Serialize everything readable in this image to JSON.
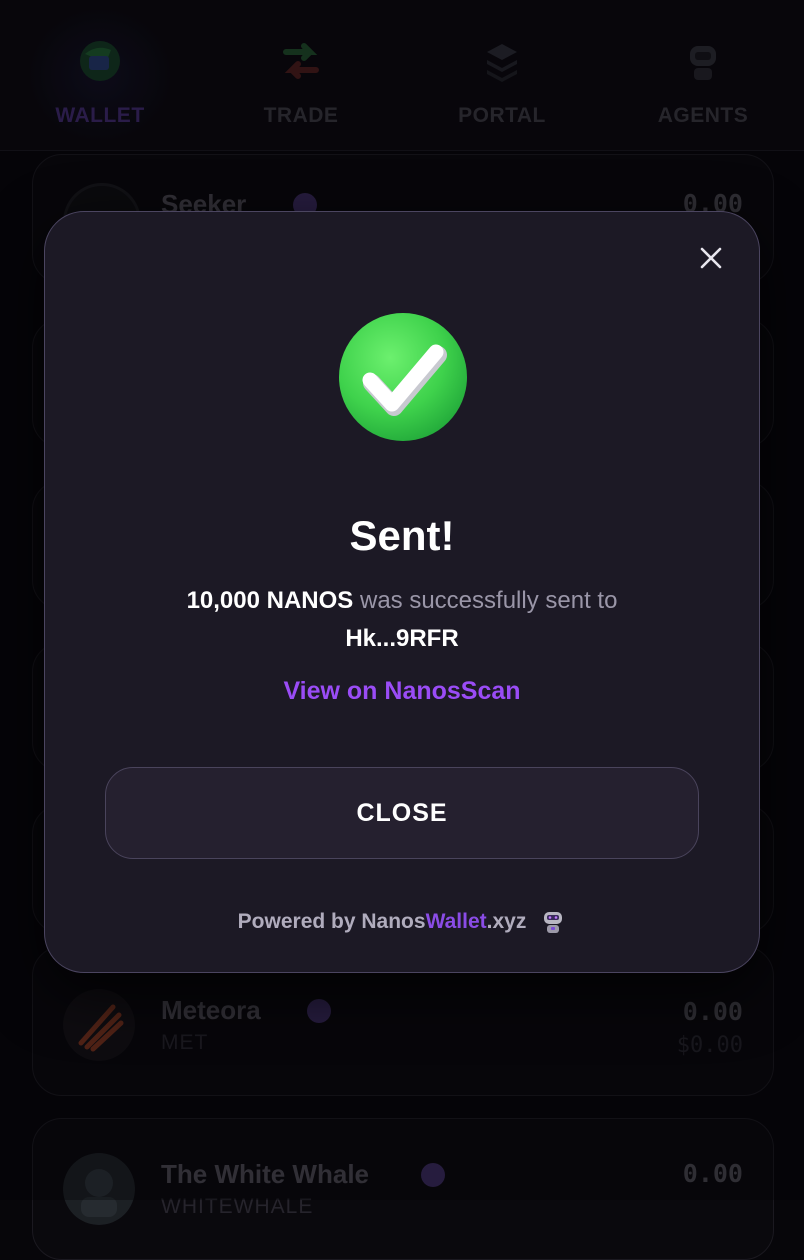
{
  "nav": {
    "items": [
      {
        "label": "WALLET",
        "icon": "wallet-globe-icon",
        "active": true
      },
      {
        "label": "TRADE",
        "icon": "swap-arrows-icon",
        "active": false
      },
      {
        "label": "PORTAL",
        "icon": "layers-icon",
        "active": false
      },
      {
        "label": "AGENTS",
        "icon": "robot-icon",
        "active": false
      }
    ]
  },
  "tokens": [
    {
      "name": "Seeker",
      "symbol": "",
      "balance": "0.00",
      "usd": ""
    },
    {
      "name": "Meteora",
      "symbol": "MET",
      "balance": "0.00",
      "usd": "$0.00"
    },
    {
      "name": "The White Whale",
      "symbol": "WHITEWHALE",
      "balance": "0.00",
      "usd": ""
    }
  ],
  "modal": {
    "title": "Sent!",
    "amount": "10,000 NANOS",
    "message_middle": "was successfully sent to",
    "recipient": "Hk...9RFR",
    "link_label": "View on NanosScan",
    "close_label": "CLOSE",
    "powered_prefix": "Powered by Nanos",
    "powered_accent": "Wallet",
    "powered_suffix": ".xyz",
    "colors": {
      "accent": "#9a4cf6",
      "success": "#3fd24c",
      "panel": "#1c1925"
    }
  }
}
